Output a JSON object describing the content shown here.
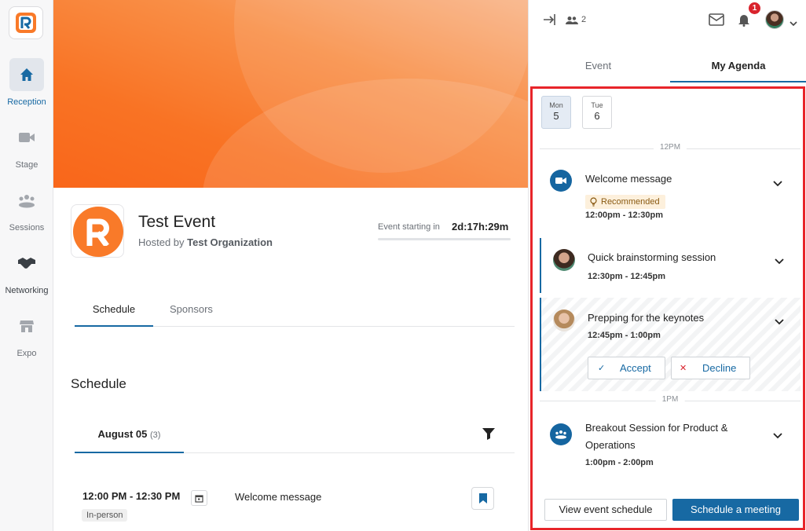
{
  "nav": {
    "items": [
      {
        "label": "Reception",
        "icon": "home-icon"
      },
      {
        "label": "Stage",
        "icon": "video-camera-icon"
      },
      {
        "label": "Sessions",
        "icon": "people-group-icon"
      },
      {
        "label": "Networking",
        "icon": "handshake-icon"
      },
      {
        "label": "Expo",
        "icon": "store-icon"
      }
    ]
  },
  "event": {
    "title": "Test Event",
    "hosted_prefix": "Hosted by",
    "host": "Test Organization",
    "countdown_label": "Event starting in",
    "countdown": "2d:17h:29m"
  },
  "main_tabs": [
    "Schedule",
    "Sponsors"
  ],
  "schedule": {
    "heading": "Schedule",
    "date_tab": "August 05",
    "date_count": "(3)",
    "first_item": {
      "time": "12:00 PM - 12:30 PM",
      "badge": "In-person",
      "title": "Welcome message"
    }
  },
  "right_panel": {
    "attendee_count": "2",
    "notification_count": "1",
    "tabs": [
      "Event",
      "My Agenda"
    ],
    "days": [
      {
        "name": "Mon",
        "num": "5"
      },
      {
        "name": "Tue",
        "num": "6"
      }
    ],
    "hour_labels": [
      "12PM",
      "1PM"
    ],
    "items": [
      {
        "title": "Welcome message",
        "badge": "Recommended",
        "time": "12:00pm - 12:30pm",
        "icon": "video-camera-icon"
      },
      {
        "title": "Quick brainstorming session",
        "time": "12:30pm - 12:45pm",
        "icon": "avatar"
      },
      {
        "title": "Prepping for the keynotes",
        "time": "12:45pm - 1:00pm",
        "icon": "avatar"
      },
      {
        "title_line1": "Breakout Session for Product &",
        "title_line2": "Operations",
        "time": "1:00pm - 2:00pm",
        "icon": "people-group-icon"
      }
    ],
    "accept_label": "Accept",
    "decline_label": "Decline",
    "view_schedule_label": "View event schedule",
    "schedule_meeting_label": "Schedule a meeting"
  }
}
